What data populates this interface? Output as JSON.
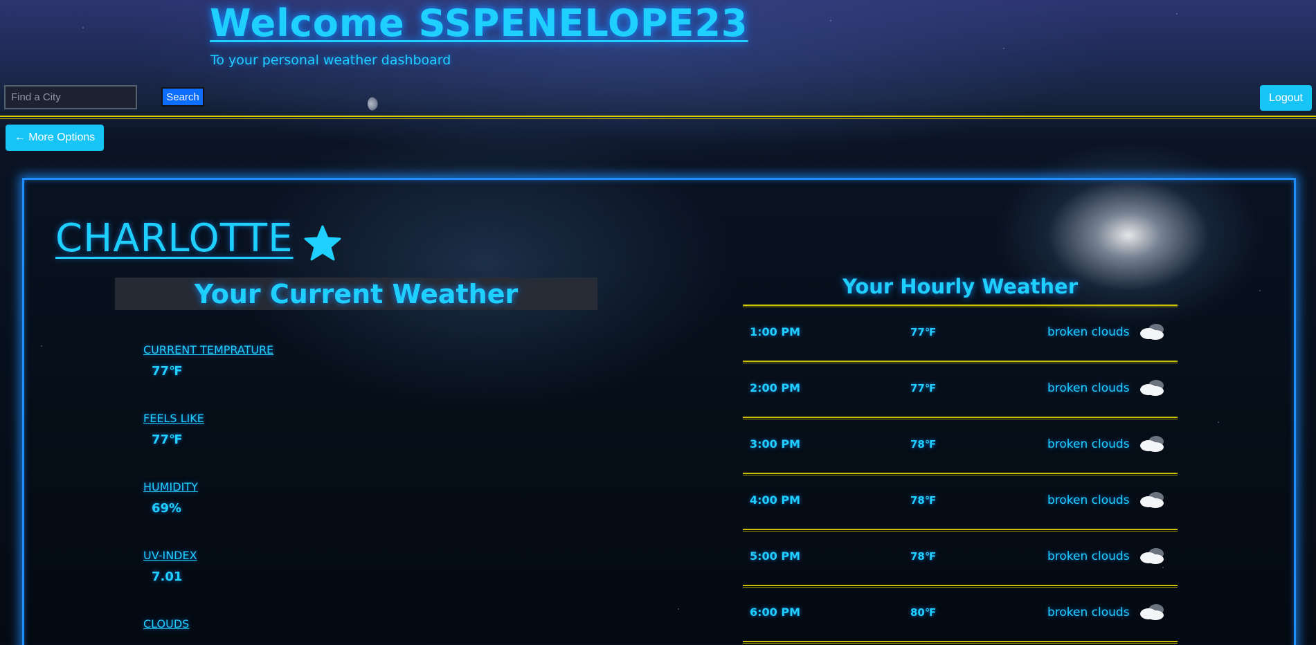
{
  "header": {
    "welcome_title": "Welcome SSPENELOPE23",
    "welcome_subtitle": "To your personal weather dashboard"
  },
  "search": {
    "placeholder": "Find a City",
    "value": "",
    "button_label": "Search"
  },
  "auth": {
    "logout_label": "Logout"
  },
  "navigation": {
    "more_options_label": "← More Options"
  },
  "city": {
    "name": "CHARLOTTE",
    "favorite_icon": "star-icon"
  },
  "current_weather": {
    "title": "Your Current Weather",
    "stats": [
      {
        "label": "CURRENT TEMPRATURE",
        "value": "77℉"
      },
      {
        "label": "FEELS LIKE",
        "value": "77℉"
      },
      {
        "label": "HUMIDITY",
        "value": "69%"
      },
      {
        "label": "UV-INDEX",
        "value": "7.01"
      },
      {
        "label": "CLOUDS",
        "value": ""
      }
    ]
  },
  "hourly_weather": {
    "title": "Your Hourly Weather",
    "rows": [
      {
        "time": "1:00 PM",
        "temp": "77℉",
        "description": "broken clouds",
        "icon": "broken-clouds-icon"
      },
      {
        "time": "2:00 PM",
        "temp": "77℉",
        "description": "broken clouds",
        "icon": "broken-clouds-icon"
      },
      {
        "time": "3:00 PM",
        "temp": "78℉",
        "description": "broken clouds",
        "icon": "broken-clouds-icon"
      },
      {
        "time": "4:00 PM",
        "temp": "78℉",
        "description": "broken clouds",
        "icon": "broken-clouds-icon"
      },
      {
        "time": "5:00 PM",
        "temp": "78℉",
        "description": "broken clouds",
        "icon": "broken-clouds-icon"
      },
      {
        "time": "6:00 PM",
        "temp": "80℉",
        "description": "broken clouds",
        "icon": "broken-clouds-icon"
      }
    ]
  },
  "colors": {
    "accent_cyan": "#1fd0ff",
    "button_cyan": "#17c4f5",
    "search_blue": "#0d6efd",
    "divider_yellow": "#d9d200",
    "panel_glow": "#1f8fff"
  }
}
